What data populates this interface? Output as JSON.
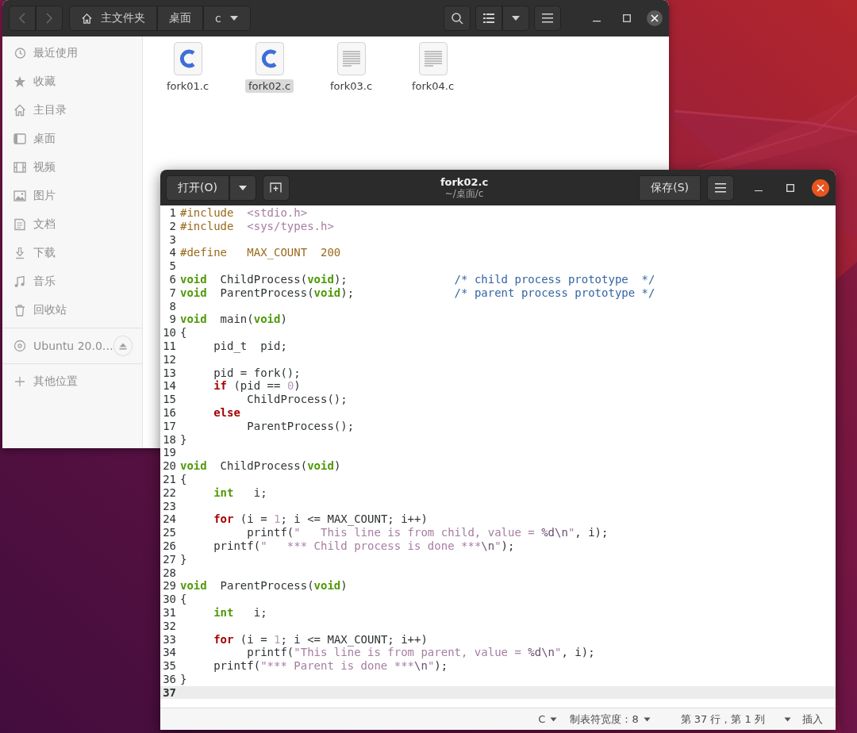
{
  "file_manager": {
    "path_bar": [
      {
        "label": "主文件夹",
        "kind": "home"
      },
      {
        "label": "桌面",
        "kind": "plain"
      },
      {
        "label": "c",
        "kind": "dropdown"
      }
    ],
    "sidebar": {
      "places": [
        {
          "label": "最近使用",
          "kind": "recent"
        },
        {
          "label": "收藏",
          "kind": "starred"
        },
        {
          "label": "主目录",
          "kind": "home"
        },
        {
          "label": "桌面",
          "kind": "desktop"
        },
        {
          "label": "视频",
          "kind": "videos"
        },
        {
          "label": "图片",
          "kind": "pictures"
        },
        {
          "label": "文档",
          "kind": "documents"
        },
        {
          "label": "下载",
          "kind": "downloads"
        },
        {
          "label": "音乐",
          "kind": "music"
        },
        {
          "label": "回收站",
          "kind": "trash"
        }
      ],
      "devices": [
        {
          "label": "Ubuntu 20.0…",
          "ejectable": true
        }
      ],
      "other": [
        {
          "label": "其他位置"
        }
      ]
    },
    "files": [
      {
        "name": "fork01.c",
        "kind": "c-source",
        "selected": false
      },
      {
        "name": "fork02.c",
        "kind": "c-source",
        "selected": true
      },
      {
        "name": "fork03.c",
        "kind": "text",
        "selected": false
      },
      {
        "name": "fork04.c",
        "kind": "text",
        "selected": false
      }
    ]
  },
  "editor": {
    "title": "fork02.c",
    "subtitle": "~/桌面/c",
    "open_button": "打开(O)",
    "save_button": "保存(S)",
    "lines": [
      {
        "number": "1",
        "current": false,
        "tokens": [
          {
            "text": "#include  ",
            "kind": "preproc"
          },
          {
            "text": "<stdio.h>",
            "kind": "string"
          }
        ]
      },
      {
        "number": "2",
        "current": false,
        "tokens": [
          {
            "text": "#include  ",
            "kind": "preproc"
          },
          {
            "text": "<sys/types.h>",
            "kind": "string"
          }
        ]
      },
      {
        "number": "3",
        "current": false
      },
      {
        "number": "4",
        "current": false,
        "tokens": [
          {
            "text": "#define   MAX_COUNT  200",
            "kind": "preproc"
          }
        ]
      },
      {
        "number": "5",
        "current": false
      },
      {
        "number": "6",
        "current": false,
        "tokens": [
          {
            "text": "void",
            "kind": "type"
          },
          {
            "text": "  ChildProcess(",
            "kind": "plain"
          },
          {
            "text": "void",
            "kind": "type"
          },
          {
            "text": ");                ",
            "kind": "plain"
          },
          {
            "text": "/* child process prototype  */",
            "kind": "comment"
          }
        ]
      },
      {
        "number": "7",
        "current": false,
        "tokens": [
          {
            "text": "void",
            "kind": "type"
          },
          {
            "text": "  ParentProcess(",
            "kind": "plain"
          },
          {
            "text": "void",
            "kind": "type"
          },
          {
            "text": ");               ",
            "kind": "plain"
          },
          {
            "text": "/* parent process prototype */",
            "kind": "comment"
          }
        ]
      },
      {
        "number": "8",
        "current": false
      },
      {
        "number": "9",
        "current": false,
        "tokens": [
          {
            "text": "void",
            "kind": "type"
          },
          {
            "text": "  main(",
            "kind": "plain"
          },
          {
            "text": "void",
            "kind": "type"
          },
          {
            "text": ")",
            "kind": "plain"
          }
        ]
      },
      {
        "number": "10",
        "current": false,
        "tokens": [
          {
            "text": "{",
            "kind": "plain"
          }
        ]
      },
      {
        "number": "11",
        "current": false,
        "tokens": [
          {
            "text": "     pid_t  pid;",
            "kind": "plain"
          }
        ]
      },
      {
        "number": "12",
        "current": false
      },
      {
        "number": "13",
        "current": false,
        "tokens": [
          {
            "text": "     pid = fork();",
            "kind": "plain"
          }
        ]
      },
      {
        "number": "14",
        "current": false,
        "tokens": [
          {
            "text": "     if",
            "kind": "keyword"
          },
          {
            "text": " (pid == ",
            "kind": "plain"
          },
          {
            "text": "0",
            "kind": "number"
          },
          {
            "text": ")",
            "kind": "plain"
          }
        ]
      },
      {
        "number": "15",
        "current": false,
        "tokens": [
          {
            "text": "          ChildProcess();",
            "kind": "plain"
          }
        ]
      },
      {
        "number": "16",
        "current": false,
        "tokens": [
          {
            "text": "     else",
            "kind": "keyword"
          }
        ]
      },
      {
        "number": "17",
        "current": false,
        "tokens": [
          {
            "text": "          ParentProcess();",
            "kind": "plain"
          }
        ]
      },
      {
        "number": "18",
        "current": false,
        "tokens": [
          {
            "text": "}",
            "kind": "plain"
          }
        ]
      },
      {
        "number": "19",
        "current": false
      },
      {
        "number": "20",
        "current": false,
        "tokens": [
          {
            "text": "void",
            "kind": "type"
          },
          {
            "text": "  ChildProcess(",
            "kind": "plain"
          },
          {
            "text": "void",
            "kind": "type"
          },
          {
            "text": ")",
            "kind": "plain"
          }
        ]
      },
      {
        "number": "21",
        "current": false,
        "tokens": [
          {
            "text": "{",
            "kind": "plain"
          }
        ]
      },
      {
        "number": "22",
        "current": false,
        "tokens": [
          {
            "text": "     int",
            "kind": "type"
          },
          {
            "text": "   i;",
            "kind": "plain"
          }
        ]
      },
      {
        "number": "23",
        "current": false
      },
      {
        "number": "24",
        "current": false,
        "tokens": [
          {
            "text": "     for",
            "kind": "keyword"
          },
          {
            "text": " (i = ",
            "kind": "plain"
          },
          {
            "text": "1",
            "kind": "number"
          },
          {
            "text": "; i <= MAX_COUNT; i++)",
            "kind": "plain"
          }
        ]
      },
      {
        "number": "25",
        "current": false,
        "tokens": [
          {
            "text": "          printf(",
            "kind": "plain"
          },
          {
            "text": "\"   This line is from child, value = ",
            "kind": "string"
          },
          {
            "text": "%d\\n",
            "kind": "escape"
          },
          {
            "text": "\"",
            "kind": "string"
          },
          {
            "text": ", i);",
            "kind": "plain"
          }
        ]
      },
      {
        "number": "26",
        "current": false,
        "tokens": [
          {
            "text": "     printf(",
            "kind": "plain"
          },
          {
            "text": "\"   *** Child process is done ***",
            "kind": "string"
          },
          {
            "text": "\\n",
            "kind": "escape"
          },
          {
            "text": "\"",
            "kind": "string"
          },
          {
            "text": ");",
            "kind": "plain"
          }
        ]
      },
      {
        "number": "27",
        "current": false,
        "tokens": [
          {
            "text": "}",
            "kind": "plain"
          }
        ]
      },
      {
        "number": "28",
        "current": false
      },
      {
        "number": "29",
        "current": false,
        "tokens": [
          {
            "text": "void",
            "kind": "type"
          },
          {
            "text": "  ParentProcess(",
            "kind": "plain"
          },
          {
            "text": "void",
            "kind": "type"
          },
          {
            "text": ")",
            "kind": "plain"
          }
        ]
      },
      {
        "number": "30",
        "current": false,
        "tokens": [
          {
            "text": "{",
            "kind": "plain"
          }
        ]
      },
      {
        "number": "31",
        "current": false,
        "tokens": [
          {
            "text": "     int",
            "kind": "type"
          },
          {
            "text": "   i;",
            "kind": "plain"
          }
        ]
      },
      {
        "number": "32",
        "current": false
      },
      {
        "number": "33",
        "current": false,
        "tokens": [
          {
            "text": "     for",
            "kind": "keyword"
          },
          {
            "text": " (i = ",
            "kind": "plain"
          },
          {
            "text": "1",
            "kind": "number"
          },
          {
            "text": "; i <= MAX_COUNT; i++)",
            "kind": "plain"
          }
        ]
      },
      {
        "number": "34",
        "current": false,
        "tokens": [
          {
            "text": "          printf(",
            "kind": "plain"
          },
          {
            "text": "\"This line is from parent, value = ",
            "kind": "string"
          },
          {
            "text": "%d\\n",
            "kind": "escape"
          },
          {
            "text": "\"",
            "kind": "string"
          },
          {
            "text": ", i);",
            "kind": "plain"
          }
        ]
      },
      {
        "number": "35",
        "current": false,
        "tokens": [
          {
            "text": "     printf(",
            "kind": "plain"
          },
          {
            "text": "\"*** Parent is done ***",
            "kind": "string"
          },
          {
            "text": "\\n",
            "kind": "escape"
          },
          {
            "text": "\"",
            "kind": "string"
          },
          {
            "text": ");",
            "kind": "plain"
          }
        ]
      },
      {
        "number": "36",
        "current": false,
        "tokens": [
          {
            "text": "}",
            "kind": "plain"
          }
        ]
      },
      {
        "number": "37",
        "current": true
      }
    ],
    "status_bar": {
      "language": "C",
      "tab_width": "制表符宽度：8",
      "position": "第 37 行，第 1 列",
      "mode": "插入"
    }
  }
}
